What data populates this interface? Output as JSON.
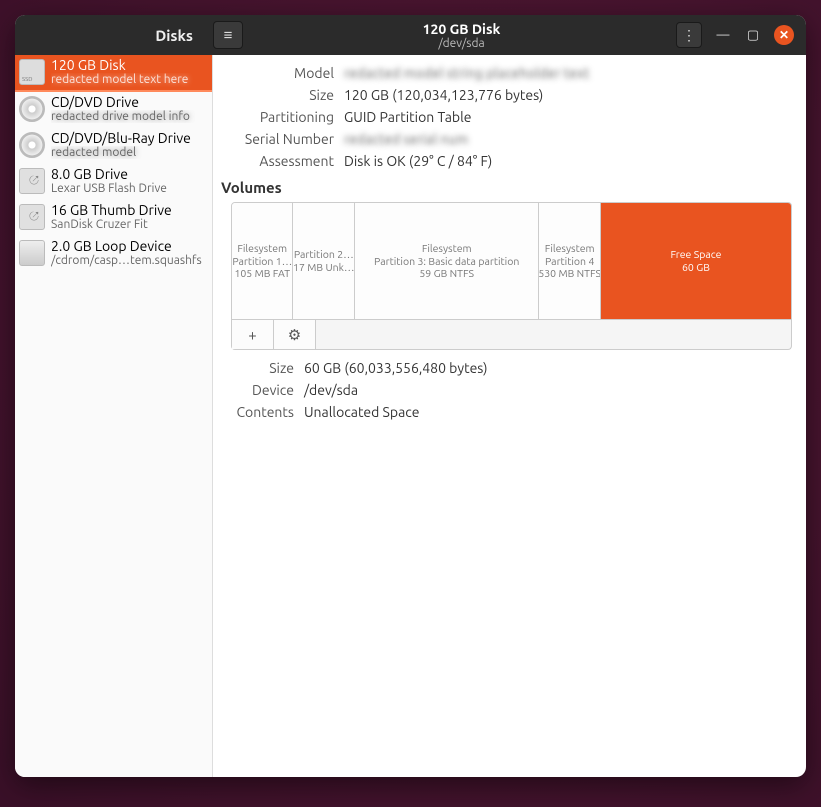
{
  "titlebar": {
    "app_title": "Disks",
    "window_title": "120 GB Disk",
    "window_subtitle": "/dev/sda"
  },
  "sidebar": {
    "items": [
      {
        "label": "120 GB Disk",
        "sub": "redacted model text here",
        "icon": "ssd",
        "selected": true,
        "sub_blur": true
      },
      {
        "label": "CD/DVD Drive",
        "sub": "redacted drive model info",
        "icon": "optical",
        "sub_blur": true
      },
      {
        "label": "CD/DVD/Blu-Ray Drive",
        "sub": "redacted model",
        "icon": "optical",
        "sub_blur": true
      },
      {
        "label": "8.0 GB Drive",
        "sub": "Lexar USB Flash Drive",
        "icon": "usb"
      },
      {
        "label": "16 GB Thumb Drive",
        "sub": "SanDisk Cruzer Fit",
        "icon": "usb"
      },
      {
        "label": "2.0 GB Loop Device",
        "sub": "/cdrom/casp…tem.squashfs",
        "icon": "hdd"
      }
    ]
  },
  "disk_info": {
    "labels": {
      "model": "Model",
      "size": "Size",
      "partitioning": "Partitioning",
      "serial": "Serial Number",
      "assessment": "Assessment"
    },
    "values": {
      "model": "redacted model string placeholder text",
      "model_blur": true,
      "size": "120 GB (120,034,123,776 bytes)",
      "partitioning": "GUID Partition Table",
      "serial": "redacted serial num",
      "serial_blur": true,
      "assessment": "Disk is OK (29° C / 84° F)"
    }
  },
  "volumes_header": "Volumes",
  "partitions": [
    {
      "l1": "Filesystem",
      "l2": "Partition 1…",
      "l3": "105 MB FAT",
      "flex": 11
    },
    {
      "l1": "",
      "l2": "Partition 2…",
      "l3": "17 MB Unk…",
      "flex": 11
    },
    {
      "l1": "Filesystem",
      "l2": "Partition 3: Basic data partition",
      "l3": "59 GB NTFS",
      "flex": 33
    },
    {
      "l1": "Filesystem",
      "l2": "Partition 4",
      "l3": "530 MB NTFS",
      "flex": 11
    },
    {
      "l1": "Free Space",
      "l2": "60 GB",
      "l3": "",
      "flex": 34,
      "selected": true
    }
  ],
  "volume_toolbar": {
    "add": "+",
    "gear": "⚙"
  },
  "selection_info": {
    "labels": {
      "size": "Size",
      "device": "Device",
      "contents": "Contents"
    },
    "values": {
      "size": "60 GB (60,033,556,480 bytes)",
      "device": "/dev/sda",
      "contents": "Unallocated Space"
    }
  }
}
